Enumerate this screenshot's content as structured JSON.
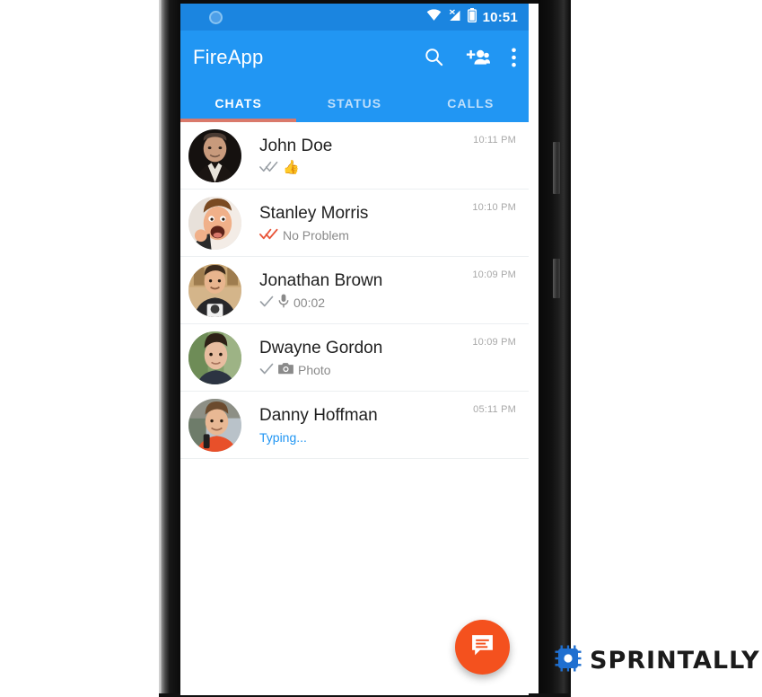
{
  "device": {
    "name": "android-phone-mockup"
  },
  "status_bar": {
    "time": "10:51",
    "icons": [
      "notification-dot-icon",
      "wifi-icon",
      "signal-off-icon",
      "battery-icon"
    ]
  },
  "app_bar": {
    "title": "FireApp",
    "actions": [
      {
        "name": "search-icon",
        "label": "Search"
      },
      {
        "name": "add-person-icon",
        "label": "New group"
      },
      {
        "name": "overflow-menu-icon",
        "label": "More options"
      }
    ]
  },
  "tabs": {
    "items": [
      {
        "label": "CHATS",
        "active": true
      },
      {
        "label": "STATUS",
        "active": false
      },
      {
        "label": "CALLS",
        "active": false
      }
    ],
    "indicator_color": "#d9796b"
  },
  "chats": [
    {
      "name": "John Doe",
      "status_icon": "double-check-grey-icon",
      "attachment_icon": "",
      "preview": "",
      "emoji": "👍",
      "time": "10:11 PM",
      "typing": false
    },
    {
      "name": "Stanley Morris",
      "status_icon": "double-check-orange-icon",
      "attachment_icon": "",
      "preview": "No Problem",
      "emoji": "",
      "time": "10:10 PM",
      "typing": false
    },
    {
      "name": "Jonathan Brown",
      "status_icon": "single-check-grey-icon",
      "attachment_icon": "microphone-icon",
      "preview": "00:02",
      "emoji": "",
      "time": "10:09 PM",
      "typing": false
    },
    {
      "name": "Dwayne Gordon",
      "status_icon": "single-check-grey-icon",
      "attachment_icon": "camera-icon",
      "preview": "Photo",
      "emoji": "",
      "time": "10:09 PM",
      "typing": false
    },
    {
      "name": "Danny Hoffman",
      "status_icon": "",
      "attachment_icon": "",
      "preview": "Typing...",
      "emoji": "",
      "time": "05:11 PM",
      "typing": true
    }
  ],
  "fab": {
    "name": "new-chat-fab",
    "icon": "chat-bubble-icon",
    "color": "#f4511e"
  },
  "watermark": {
    "text": "SPRINTALLY",
    "icon": "gear-chip-icon",
    "icon_color": "#1f6fd0"
  },
  "colors": {
    "app_bar": "#2196f3",
    "status_bar": "#1b85e0",
    "accent": "#f4511e",
    "tab_indicator": "#d9796b",
    "typing": "#2196f3",
    "check_read": "#e8563a",
    "check_sent": "#9aa0a6"
  }
}
